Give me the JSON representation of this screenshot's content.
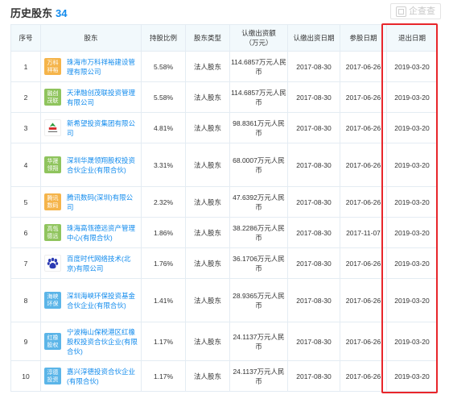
{
  "header": {
    "title": "历史股东",
    "count": "34",
    "button_label": "企查查"
  },
  "colors": {
    "link": "#128bed",
    "highlight": "#e8262b",
    "header_bg": "#f2f9fc"
  },
  "columns": [
    "序号",
    "股东",
    "持股比例",
    "股东类型",
    "认缴出资额\n（万元）",
    "认缴出资日期",
    "参股日期",
    "退出日期"
  ],
  "rows": [
    {
      "no": "1",
      "logo_text": "万科祥裕",
      "logo_color": "#f5b44a",
      "name": "珠海市万科祥裕建设管理有限公司",
      "ratio": "5.58%",
      "type": "法人股东",
      "amount": "114.6857万元人民币",
      "sub_date": "2017-08-30",
      "join_date": "2017-06-26",
      "exit_date": "2019-03-20"
    },
    {
      "no": "2",
      "logo_text": "融创茂联",
      "logo_color": "#8fc45d",
      "name": "天津融创茂联投资管理有限公司",
      "ratio": "5.58%",
      "type": "法人股东",
      "amount": "114.6857万元人民币",
      "sub_date": "2017-08-30",
      "join_date": "2017-06-26",
      "exit_date": "2019-03-20"
    },
    {
      "no": "3",
      "logo_text": "",
      "logo_color": "#ffffff",
      "logo_icon": "new-hope-logo-icon",
      "name": "新希望投资集团有限公司",
      "ratio": "4.81%",
      "type": "法人股东",
      "amount": "98.8361万元人民币",
      "sub_date": "2017-08-30",
      "join_date": "2017-06-26",
      "exit_date": "2019-03-20"
    },
    {
      "no": "4",
      "logo_text": "华晟领翔",
      "logo_color": "#8fc45d",
      "name": "深圳华晟领翔股权投资合伙企业(有限合伙)",
      "ratio": "3.31%",
      "type": "法人股东",
      "amount": "68.0007万元人民币",
      "sub_date": "2017-08-30",
      "join_date": "2017-06-26",
      "exit_date": "2019-03-20"
    },
    {
      "no": "5",
      "logo_text": "腾讯数码",
      "logo_color": "#f5b44a",
      "name": "腾讯数码(深圳)有限公司",
      "ratio": "2.32%",
      "type": "法人股东",
      "amount": "47.6392万元人民币",
      "sub_date": "2017-08-30",
      "join_date": "2017-06-26",
      "exit_date": "2019-03-20"
    },
    {
      "no": "6",
      "logo_text": "高瓴德远",
      "logo_color": "#8fc45d",
      "name": "珠海高瓴德远资产管理中心(有限合伙)",
      "ratio": "1.86%",
      "type": "法人股东",
      "amount": "38.2286万元人民币",
      "sub_date": "2017-08-30",
      "join_date": "2017-11-07",
      "exit_date": "2019-03-20"
    },
    {
      "no": "7",
      "logo_text": "",
      "logo_color": "#ffffff",
      "logo_icon": "baidu-paw-icon",
      "name": "百度时代网络技术(北京)有限公司",
      "ratio": "1.76%",
      "type": "法人股东",
      "amount": "36.1706万元人民币",
      "sub_date": "2017-08-30",
      "join_date": "2017-06-26",
      "exit_date": "2019-03-20"
    },
    {
      "no": "8",
      "logo_text": "海峡环保",
      "logo_color": "#5bb5e8",
      "name": "深圳海峡环保投资基金合伙企业(有限合伙)",
      "ratio": "1.41%",
      "type": "法人股东",
      "amount": "28.9365万元人民币",
      "sub_date": "2017-08-30",
      "join_date": "2017-06-26",
      "exit_date": "2019-03-20"
    },
    {
      "no": "9",
      "logo_text": "红橡股权",
      "logo_color": "#5bb5e8",
      "name": "宁波梅山保税港区红橡股权投资合伙企业(有限合伙)",
      "ratio": "1.17%",
      "type": "法人股东",
      "amount": "24.1137万元人民币",
      "sub_date": "2017-08-30",
      "join_date": "2017-06-26",
      "exit_date": "2019-03-20"
    },
    {
      "no": "10",
      "logo_text": "淳德投资",
      "logo_color": "#5bb5e8",
      "name": "嘉兴淳德投资合伙企业(有限合伙)",
      "ratio": "1.17%",
      "type": "法人股东",
      "amount": "24.1137万元人民币",
      "sub_date": "2017-08-30",
      "join_date": "2017-06-26",
      "exit_date": "2019-03-20"
    }
  ]
}
